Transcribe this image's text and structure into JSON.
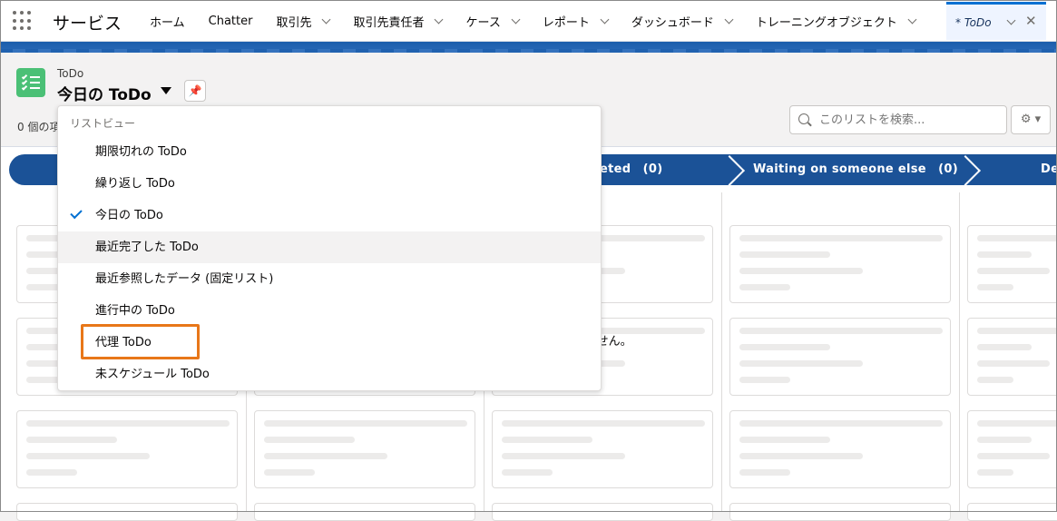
{
  "nav": {
    "app_name": "サービス",
    "tabs": [
      {
        "label": "ホーム",
        "has_menu": false
      },
      {
        "label": "Chatter",
        "has_menu": false
      },
      {
        "label": "取引先",
        "has_menu": true
      },
      {
        "label": "取引先責任者",
        "has_menu": true
      },
      {
        "label": "ケース",
        "has_menu": true
      },
      {
        "label": "レポート",
        "has_menu": true
      },
      {
        "label": "ダッシュボード",
        "has_menu": true
      },
      {
        "label": "トレーニングオブジェクト",
        "has_menu": true
      }
    ],
    "active_tab": "* ToDo"
  },
  "header": {
    "object_label": "ToDo",
    "view_title": "今日の ToDo",
    "count_text": "0 個の項",
    "search_placeholder": "このリストを検索...",
    "gear_label": "⚙ ▾"
  },
  "kanban": {
    "stages": [
      {
        "label": "eted　(0)"
      },
      {
        "label": "Waiting on someone else　(0)"
      },
      {
        "label": "De"
      }
    ],
    "empty_message": "りません。"
  },
  "dropdown": {
    "header": "リストビュー",
    "items": [
      {
        "label": "期限切れの ToDo",
        "selected": false
      },
      {
        "label": "繰り返し ToDo",
        "selected": false
      },
      {
        "label": "今日の ToDo",
        "selected": true
      },
      {
        "label": "最近完了した ToDo",
        "selected": false,
        "hovered": true
      },
      {
        "label": "最近参照したデータ (固定リスト)",
        "selected": false
      },
      {
        "label": "進行中の ToDo",
        "selected": false
      },
      {
        "label": "代理 ToDo",
        "selected": false,
        "highlighted": true
      },
      {
        "label": "未スケジュール ToDo",
        "selected": false
      }
    ]
  },
  "colors": {
    "stage_bar": "#1b5297",
    "highlight": "#e87719",
    "check": "#0070d2",
    "todo_icon": "#4bc076"
  }
}
